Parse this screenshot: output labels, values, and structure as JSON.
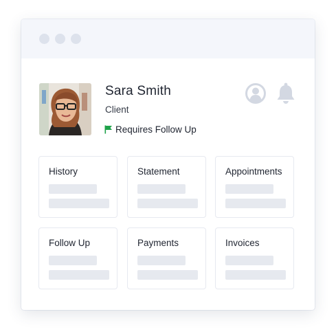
{
  "window": {
    "controls": [
      "control-dot",
      "control-dot",
      "control-dot"
    ]
  },
  "profile": {
    "name": "Sara Smith",
    "role": "Client",
    "status": "Requires Follow Up",
    "status_icon": "flag-icon",
    "status_color": "#1fa24a"
  },
  "header_icons": [
    "user-circle-icon",
    "bell-icon"
  ],
  "cards": [
    {
      "title": "History"
    },
    {
      "title": "Statement"
    },
    {
      "title": "Appointments"
    },
    {
      "title": "Follow Up"
    },
    {
      "title": "Payments"
    },
    {
      "title": "Invoices"
    }
  ],
  "colors": {
    "titlebar": "#f4f6fb",
    "dots": "#dde2ec",
    "icon_gray": "#d3d8e2",
    "placeholder": "#e6e9ef",
    "text": "#1f2430"
  }
}
